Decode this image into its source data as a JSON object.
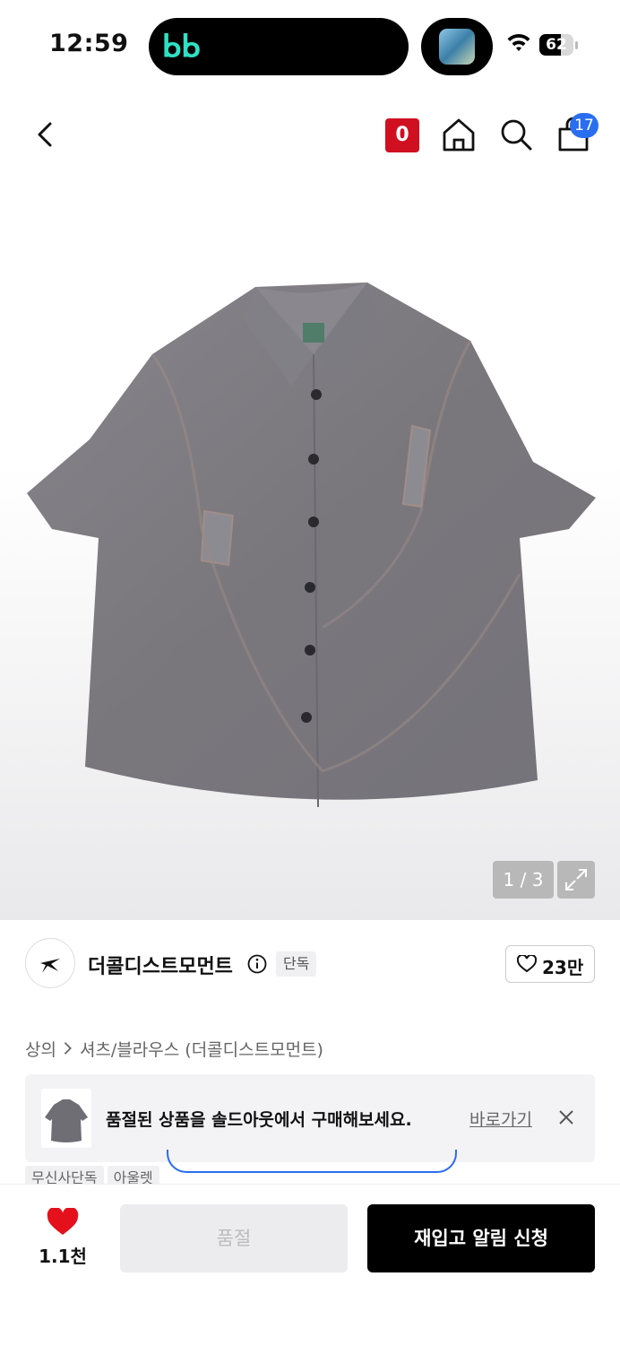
{
  "status_bar": {
    "time": "12:59",
    "island_app_glyph": "ᖯᖯ",
    "battery_level": "62",
    "battery_fraction": 0.62
  },
  "nav": {
    "zero_badge": "0",
    "cart_count": "17",
    "icons": [
      "back-arrow-icon",
      "home-icon",
      "search-icon",
      "shopping-bag-icon"
    ]
  },
  "gallery": {
    "counter": "1 / 3"
  },
  "brand": {
    "name": "더콜디스트모먼트",
    "exclusive_tag": "단독",
    "likes": "23만"
  },
  "breadcrumb": {
    "category": "상의",
    "subcategory": "셔츠/블라우스 (더콜디스트모먼트)"
  },
  "soldout_banner": {
    "message": "품절된 상품을 솔드아웃에서 구매해보세요.",
    "link": "바로가기"
  },
  "tags": [
    "무신사단독",
    "아울렛"
  ],
  "bottom_bar": {
    "wish_count": "1.1천",
    "soldout_label": "품절",
    "restock_label": "재입고 알림 신청"
  },
  "colors": {
    "accent_red": "#d01020",
    "badge_blue": "#2a6ef0",
    "primary_black": "#000000",
    "shirt_gray": "#7b7a80"
  }
}
